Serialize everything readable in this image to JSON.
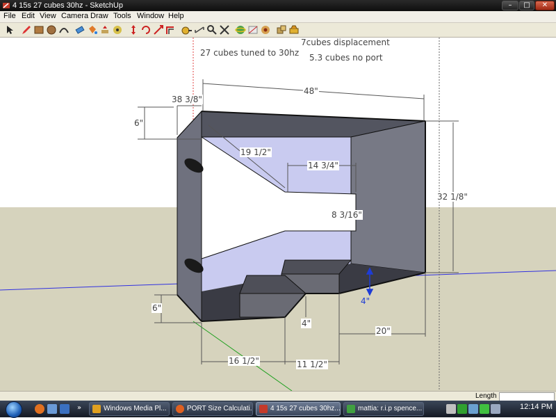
{
  "window": {
    "title": "4 15s 27 cubes 30hz - SketchUp",
    "minimize": "–",
    "maximize": "□",
    "close": "✕"
  },
  "menu": [
    "File",
    "Edit",
    "View",
    "Camera",
    "Draw",
    "Tools",
    "Window",
    "Help"
  ],
  "toolbar": {
    "tools": [
      "select-icon",
      "pencil-icon",
      "rectangle-icon",
      "circle-icon",
      "arc-icon",
      "eraser-icon",
      "paint-bucket-icon",
      "push-pull-icon",
      "follow-me-icon",
      "move-icon",
      "rotate-icon",
      "scale-icon",
      "offset-icon",
      "tape-measure-icon",
      "dimension-icon",
      "zoom-icon",
      "zoom-extents-icon",
      "orbit-icon",
      "section-icon",
      "walk-icon",
      "camera-icon",
      "components-icon",
      "materials-icon"
    ]
  },
  "annotations": {
    "tuned": "27 cubes tuned to 30hz",
    "displacement": "7cubes displacement",
    "no_port": "5.3 cubes no port"
  },
  "dimensions": {
    "depth": "38 3/8\"",
    "width": "48\"",
    "height": "32 1/8\"",
    "top_gap": "6\"",
    "bottom_gap": "6\"",
    "port_diag": "19 1/2\"",
    "port_length": "14 3/4\"",
    "port_height": "8 3/16\"",
    "step_height_blue": "4\"",
    "step_height": "4\"",
    "base_left": "16 1/2\"",
    "base_mid": "11 1/2\"",
    "base_right": "20\""
  },
  "status": {
    "length_label": "Length",
    "length_value": ""
  },
  "taskbar": {
    "tasks": [
      "Windows Media Pl...",
      "PORT Size Calculati...",
      "4 15s 27 cubes 30hz...",
      "mattia: r.i.p spence..."
    ],
    "clock": "12:14 PM"
  }
}
